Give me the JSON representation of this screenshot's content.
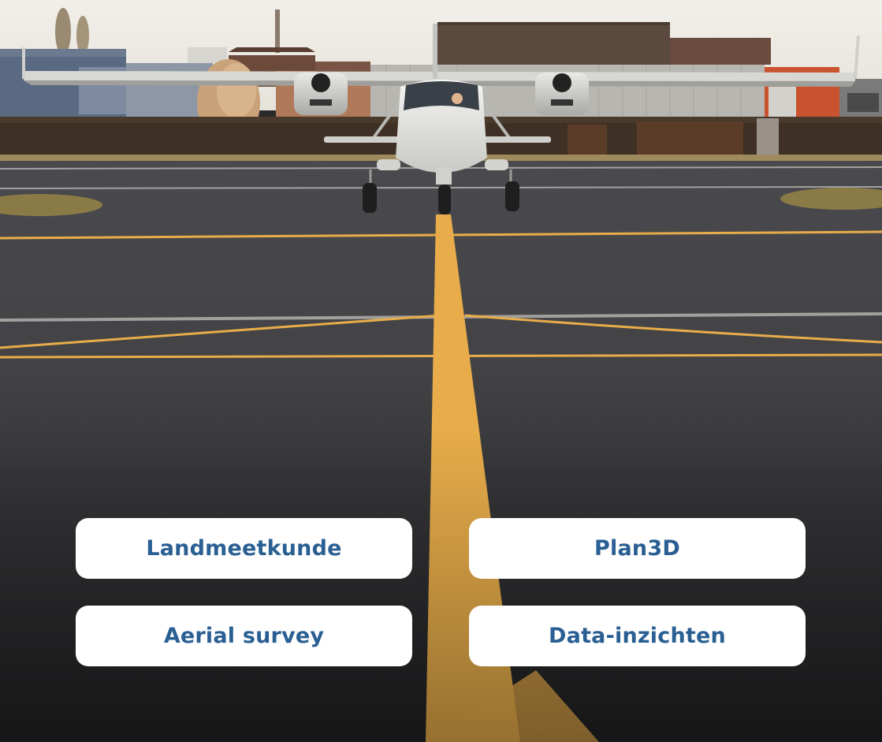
{
  "hero": {
    "photo_subject": "aircraft-on-runway",
    "colors": {
      "sky": "#ecebe6",
      "tarmac": "#3a3a3d",
      "centerline": "#e8ad4a",
      "button_bg": "#ffffff",
      "button_text": "#2a5f93"
    }
  },
  "services": [
    {
      "label": "Landmeetkunde"
    },
    {
      "label": "Plan3D"
    },
    {
      "label": "Aerial survey"
    },
    {
      "label": "Data-inzichten"
    }
  ]
}
